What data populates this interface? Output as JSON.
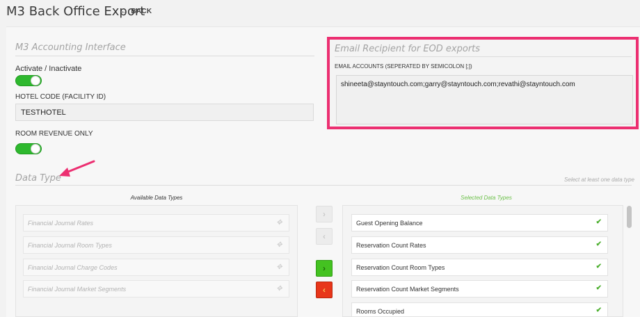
{
  "header": {
    "title": "M3 Back Office Export",
    "back_label": "BACK",
    "back_arrow": "←"
  },
  "m3": {
    "section_title": "M3 Accounting Interface",
    "activate_label": "Activate / Inactivate",
    "activate_on": true,
    "hotel_code_label": "HOTEL CODE (FACILITY ID)",
    "hotel_code_value": "TESTHOTEL",
    "room_revenue_label": "ROOM REVENUE ONLY",
    "room_revenue_on": true
  },
  "email": {
    "section_title": "Email Recipient for EOD exports",
    "accounts_label": "EMAIL ACCOUNTS (SEPERATED BY SEMICOLON [;])",
    "accounts_value": "shineeta@stayntouch.com;garry@stayntouch.com;revathi@stayntouch.com",
    "highlight_color": "#ec2f71"
  },
  "data_type": {
    "section_title": "Data Type",
    "hint": "Select at least one data type",
    "available_heading": "Available Data Types",
    "selected_heading": "Selected Data Types",
    "available": [
      "Financial Journal Rates",
      "Financial Journal Room Types",
      "Financial Journal Charge Codes",
      "Financial Journal Market Segments"
    ],
    "selected": [
      "Guest Opening Balance",
      "Reservation Count Rates",
      "Reservation Count Room Types",
      "Reservation Count Market Segments",
      "Rooms Occupied"
    ],
    "buttons": {
      "move_right": "›",
      "move_left": "‹",
      "move_all_right": "›",
      "move_all_left": "‹"
    }
  },
  "icons": {
    "drag": "✥",
    "check": "✔"
  },
  "colors": {
    "toggle_on": "#2eb82e",
    "selected_heading": "#6cc04a",
    "annotation_arrow": "#ec2f71"
  }
}
